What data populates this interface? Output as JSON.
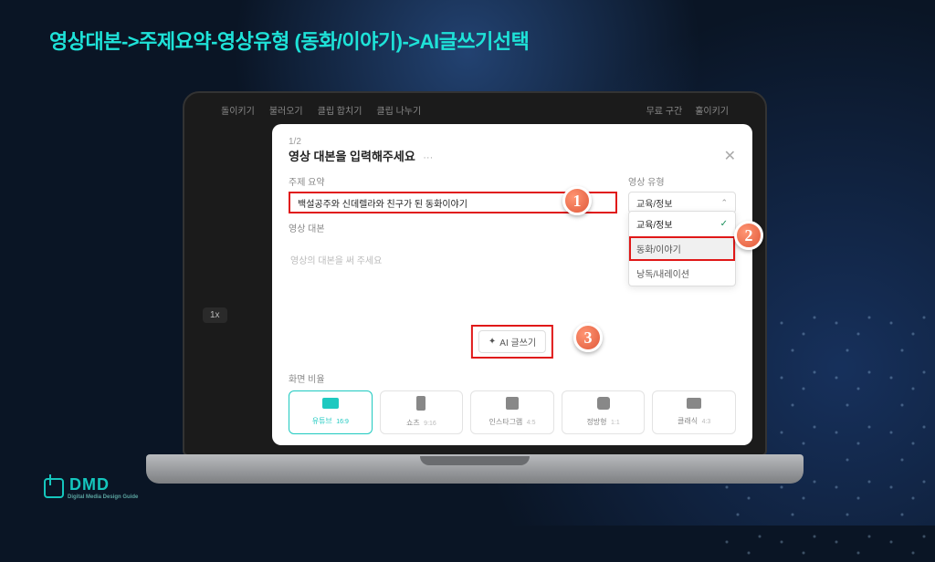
{
  "slide": {
    "breadcrumb_title": "영상대본->주제요약-영상유형 (동화/이야기)->AI글쓰기선택"
  },
  "toolbar": {
    "items_left": [
      "돌이키기",
      "불러오기",
      "클립 합치기",
      "클립 나누기"
    ],
    "items_right": [
      "무료 구간",
      "훌이키기"
    ]
  },
  "timeline": {
    "speed": "1x"
  },
  "modal": {
    "step": "1/2",
    "title": "영상 대본을 입력해주세요",
    "more": "···",
    "subject_label": "주제 요약",
    "subject_value": "백설공주와 신데렐라와 친구가 된 동화이야기",
    "type_label": "영상 유형",
    "type_value": "교육/정보",
    "type_options": [
      {
        "label": "교육/정보",
        "selected": true
      },
      {
        "label": "동화/이야기",
        "highlight": true
      },
      {
        "label": "낭독/내레이션"
      }
    ],
    "script_label": "영상 대본",
    "script_placeholder": "영상의 대본을 써 주세요",
    "ai_write": "AI 글쓰기",
    "ratio_label": "화면 비율",
    "ratios": [
      {
        "name": "유튜브",
        "sub": "16:9",
        "active": true,
        "shape": "wide"
      },
      {
        "name": "쇼츠",
        "sub": "9:16",
        "shape": "vert"
      },
      {
        "name": "인스타그램",
        "sub": "4:5",
        "shape": "square"
      },
      {
        "name": "정방형",
        "sub": "1:1",
        "shape": "sq2"
      },
      {
        "name": "클래식",
        "sub": "4:3",
        "shape": "classic"
      }
    ]
  },
  "badges": {
    "one": "1",
    "two": "2",
    "three": "3"
  },
  "brand": {
    "name": "DMD",
    "sub": "Digital Media Design Guide"
  }
}
